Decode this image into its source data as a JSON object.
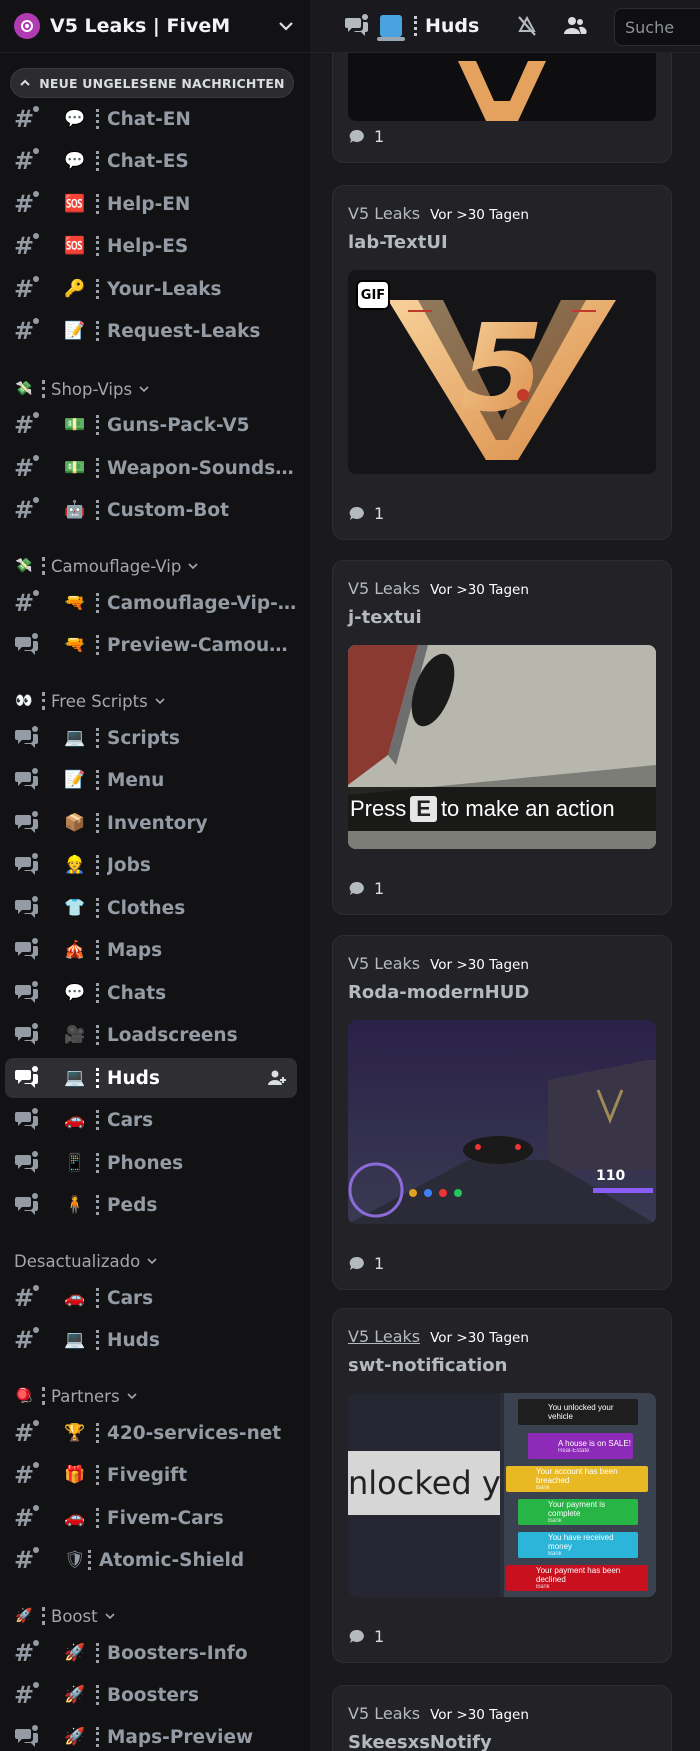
{
  "server": {
    "name": "V5 Leaks | FiveM"
  },
  "unread_banner": "NEUE UNGELESENE NACHRICHTEN",
  "channels": [
    {
      "name": "Chat-EN",
      "emoji": "💬",
      "type": "text"
    },
    {
      "name": "Chat-ES",
      "emoji": "💬",
      "type": "text"
    },
    {
      "name": "Help-EN",
      "emoji": "🆘",
      "type": "text"
    },
    {
      "name": "Help-ES",
      "emoji": "🆘",
      "type": "text"
    },
    {
      "name": "Your-Leaks",
      "emoji": "🔑",
      "type": "text"
    },
    {
      "name": "Request-Leaks",
      "emoji": "📝",
      "type": "text"
    },
    {
      "name": "Guns-Pack-V5",
      "emoji": "💵",
      "type": "text"
    },
    {
      "name": "Weapon-Sounds-...",
      "emoji": "💵",
      "type": "text"
    },
    {
      "name": "Custom-Bot",
      "emoji": "🤖",
      "type": "text"
    },
    {
      "name": "Camouflage-Vip-I...",
      "emoji": "🔫",
      "type": "text"
    },
    {
      "name": "Preview-Camoufl...",
      "emoji": "🔫",
      "type": "forum"
    },
    {
      "name": "Scripts",
      "emoji": "💻",
      "type": "forum"
    },
    {
      "name": "Menu",
      "emoji": "📝",
      "type": "forum"
    },
    {
      "name": "Inventory",
      "emoji": "📦",
      "type": "forum"
    },
    {
      "name": "Jobs",
      "emoji": "👷",
      "type": "forum"
    },
    {
      "name": "Clothes",
      "emoji": "👕",
      "type": "forum"
    },
    {
      "name": "Maps",
      "emoji": "🎪",
      "type": "forum"
    },
    {
      "name": "Chats",
      "emoji": "💬",
      "type": "forum"
    },
    {
      "name": "Loadscreens",
      "emoji": "🎥",
      "type": "forum"
    },
    {
      "name": "Huds",
      "emoji": "💻",
      "type": "forum"
    },
    {
      "name": "Cars",
      "emoji": "🚗",
      "type": "forum"
    },
    {
      "name": "Phones",
      "emoji": "📱",
      "type": "forum"
    },
    {
      "name": "Peds",
      "emoji": "🧍",
      "type": "forum"
    },
    {
      "name": "Cars",
      "emoji": "🚗",
      "type": "text"
    },
    {
      "name": "Huds",
      "emoji": "💻",
      "type": "text"
    },
    {
      "name": "420-services-net",
      "emoji": "🏆",
      "type": "text"
    },
    {
      "name": "Fivegift",
      "emoji": "🎁",
      "type": "text"
    },
    {
      "name": "Fivem-Cars",
      "emoji": "🚗",
      "type": "text"
    },
    {
      "name": "Atomic-Shield",
      "emoji": "🛡",
      "type": "text"
    },
    {
      "name": "Boosters-Info",
      "emoji": "🚀",
      "type": "text"
    },
    {
      "name": "Boosters",
      "emoji": "🚀",
      "type": "text"
    },
    {
      "name": "Maps-Preview",
      "emoji": "🚀",
      "type": "forum"
    }
  ],
  "categories": [
    {
      "name": "Shop-Vips",
      "emoji": "💸"
    },
    {
      "name": "Camouflage-Vip",
      "emoji": "💸"
    },
    {
      "name": "Free Scripts",
      "emoji": "👀"
    },
    {
      "name": "Desactualizado",
      "emoji": ""
    },
    {
      "name": "Partners",
      "emoji": "🪀"
    },
    {
      "name": "Boost",
      "emoji": "🚀"
    }
  ],
  "topbar": {
    "title": "Huds",
    "search_placeholder": "Suche"
  },
  "posts": [
    {
      "author": "V5 Leaks",
      "time": "Vor >30 Tagen",
      "title": "",
      "replies": "1"
    },
    {
      "author": "V5 Leaks",
      "time": "Vor >30 Tagen",
      "title": "lab-TextUI",
      "replies": "1",
      "badge": "GIF"
    },
    {
      "author": "V5 Leaks",
      "time": "Vor >30 Tagen",
      "title": "j-textui",
      "replies": "1",
      "image_text": {
        "before": "Press",
        "key": "E",
        "after": "to make an action"
      }
    },
    {
      "author": "V5 Leaks",
      "time": "Vor >30 Tagen",
      "title": "Roda-modernHUD",
      "replies": "1",
      "hud_speed": "110"
    },
    {
      "author": "V5 Leaks",
      "time": "Vor >30 Tagen",
      "title": "swt-notification",
      "replies": "1",
      "image_text": "nlocked yo",
      "notifications": [
        {
          "title": "You unlocked your vehicle",
          "sub": "",
          "color": "#1e1e1e"
        },
        {
          "title": "A house is on SALE!",
          "sub": "Real-Estate",
          "color": "#8e2ab8"
        },
        {
          "title": "Your account has been breached",
          "sub": "Bank",
          "color": "#e8b923"
        },
        {
          "title": "Your payment is complete",
          "sub": "Bank",
          "color": "#27b546"
        },
        {
          "title": "You have received money",
          "sub": "Bank",
          "color": "#2bb5d8"
        },
        {
          "title": "Your payment has been declined",
          "sub": "Bank",
          "color": "#c8101e"
        }
      ]
    },
    {
      "author": "V5 Leaks",
      "time": "Vor >30 Tagen",
      "title": "SkeesxsNotify",
      "replies": ""
    }
  ],
  "colors": {
    "sidebar_bg": "#121214",
    "main_bg": "#1a1a1e",
    "card_bg": "#222227",
    "active_channel": "#2e2e33"
  }
}
